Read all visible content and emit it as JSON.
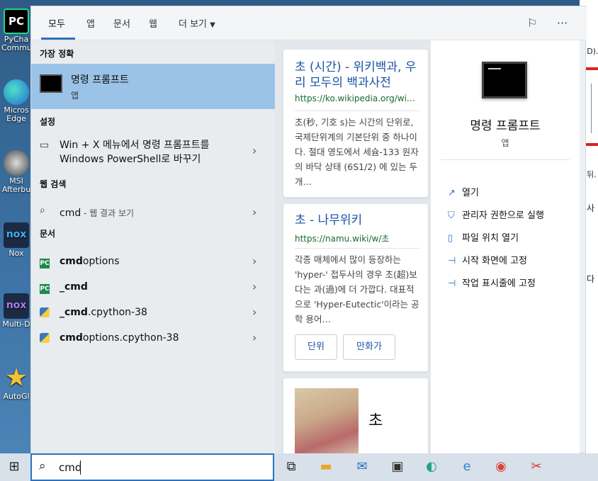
{
  "desktop_icons": [
    {
      "label": "PyCha Commu",
      "color": "#21d789"
    },
    {
      "label": "Micros Edge",
      "color": "#1f9ede"
    },
    {
      "label": "MSI Afterbu",
      "color": "#888888"
    },
    {
      "label": "Nox",
      "color": "#21334f"
    },
    {
      "label": "Multi-D",
      "color": "#21334f"
    },
    {
      "label": "AutoGl",
      "color": "#f2c230"
    }
  ],
  "tabs": {
    "all": "모두",
    "apps": "앱",
    "docs": "문서",
    "web": "웹",
    "more": "더 보기"
  },
  "left": {
    "best_match_heading": "가장 정확",
    "best_title": "명령 프롬프트",
    "best_sub": "앱",
    "settings_heading": "설정",
    "settings_item": "Win + X 메뉴에서 명령 프롬프트를 Windows PowerShell로 바꾸기",
    "web_heading": "웹 검색",
    "web_query": "cmd",
    "web_suffix": " - 웹 결과 보기",
    "docs_heading": "문서",
    "docs": [
      {
        "bold": "cmd",
        "rest": "options",
        "type": "pc"
      },
      {
        "bold": "_cmd",
        "rest": "",
        "type": "pc"
      },
      {
        "bold": "_cmd",
        "rest": ".cpython-38",
        "type": "py"
      },
      {
        "bold": "cmd",
        "rest": "options.cpython-38",
        "type": "py"
      }
    ]
  },
  "cards": [
    {
      "title": "초 (시간) - 위키백과, 우리 모두의 백과사전",
      "url": "https://ko.wikipedia.org/wi…",
      "body": "초(秒, 기호 s)는 시간의 단위로, 국제단위계의 기본단위 중 하나이다. 절대 영도에서 세슘-133 원자의 바닥 상태 (6S1/2) 에 있는 두 개…"
    },
    {
      "title": "초 - 나무위키",
      "url": "https://namu.wiki/w/초",
      "body": "각종 매체에서 많이 등장하는 'hyper-' 접두사의 경우 초(超)보다는 과(過)에 더 가깝다. 대표적으로 'Hyper-Eutectic'이라는 공학 용어…",
      "chips": [
        "단위",
        "만화가"
      ]
    },
    {
      "title": "초"
    }
  ],
  "right": {
    "title": "명령 프롬프트",
    "sub": "앱",
    "actions": [
      {
        "label": "열기",
        "icon": "open-icon"
      },
      {
        "label": "관리자 권한으로 실행",
        "icon": "admin-shield-icon"
      },
      {
        "label": "파일 위치 열기",
        "icon": "file-location-icon"
      },
      {
        "label": "시작 화면에 고정",
        "icon": "pin-icon"
      },
      {
        "label": "작업 표시줄에 고정",
        "icon": "pin-icon"
      }
    ]
  },
  "search": {
    "value": "cmd"
  },
  "bg": {
    "t1": "(D).",
    "t2": "뒤.",
    "t3": "사",
    "t4": "다"
  }
}
